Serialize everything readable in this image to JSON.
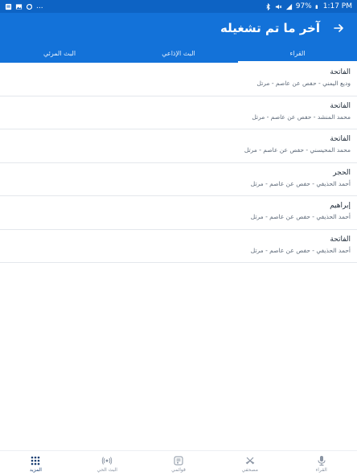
{
  "status_bar": {
    "time": "1:17 PM",
    "battery": "97%",
    "more": "..."
  },
  "app_bar": {
    "title": "آخر ما تم تشغيله"
  },
  "tabs": [
    {
      "label": "القراء",
      "active": true
    },
    {
      "label": "البث الإذاعي",
      "active": false
    },
    {
      "label": "البث المرئي",
      "active": false
    }
  ],
  "recent_items": [
    {
      "surah": "الفاتحة",
      "meta": "وديع اليمني - حفص عن عاصم - مرتل"
    },
    {
      "surah": "الفاتحة",
      "meta": "محمد المنشد - حفص عن عاصم - مرتل"
    },
    {
      "surah": "الفاتحة",
      "meta": "محمد المحيسني - حفص عن عاصم - مرتل"
    },
    {
      "surah": "الحجر",
      "meta": "أحمد الحذيفي - حفص عن عاصم - مرتل"
    },
    {
      "surah": "إبراهيم",
      "meta": "أحمد الحذيفي - حفص عن عاصم - مرتل"
    },
    {
      "surah": "الفاتحة",
      "meta": "أحمد الحذيفي - حفص عن عاصم - مرتل"
    }
  ],
  "bottom_nav": [
    {
      "label": "القراء",
      "icon": "microphone-icon"
    },
    {
      "label": "مصحفي",
      "icon": "quran-icon"
    },
    {
      "label": "قوائمي",
      "icon": "playlist-icon"
    },
    {
      "label": "البث الحي",
      "icon": "live-broadcast-icon"
    },
    {
      "label": "المزيد",
      "icon": "more-grid-icon",
      "active": true
    }
  ],
  "colors": {
    "primary": "#1372d9",
    "status_bar": "#0d63c4",
    "active_nav": "#1b3f73",
    "inactive_nav": "#8a94a3"
  }
}
